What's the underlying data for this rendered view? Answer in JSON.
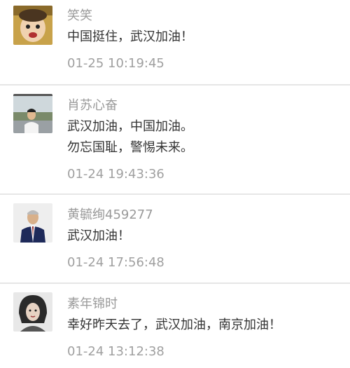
{
  "comments": [
    {
      "username": "笑笑",
      "lines": [
        "中国挺住，武汉加油！"
      ],
      "time": "01-25 10:19:45",
      "avatar": "child-face-avatar"
    },
    {
      "username": "肖苏心奋",
      "lines": [
        "武汉加油，中国加油。",
        "勿忘国耻，警惕未来。"
      ],
      "time": "01-24 19:43:36",
      "avatar": "man-outdoor-avatar"
    },
    {
      "username": "黄毓绚459277",
      "lines": [
        "武汉加油！"
      ],
      "time": "01-24 17:56:48",
      "avatar": "man-in-suit-avatar"
    },
    {
      "username": "素年锦时",
      "lines": [
        "幸好昨天去了，武汉加油，南京加油！"
      ],
      "time": "01-24 13:12:38",
      "avatar": "woman-portrait-avatar"
    }
  ]
}
